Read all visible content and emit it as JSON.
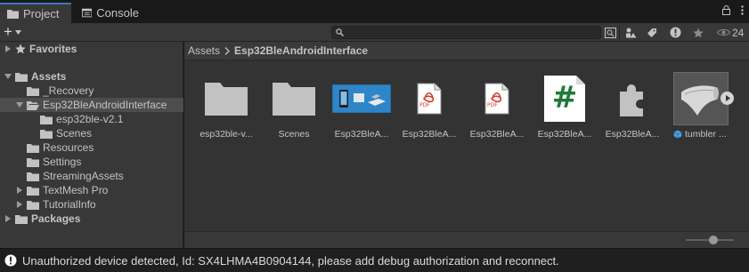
{
  "tabs": [
    {
      "label": "Project",
      "icon": "folder-icon",
      "active": true
    },
    {
      "label": "Console",
      "icon": "console-icon",
      "active": false
    }
  ],
  "toolbar": {
    "add_label": "+",
    "search_value": "",
    "hidden_count": "24"
  },
  "tree": {
    "favorites": "Favorites",
    "assets": "Assets",
    "recovery": "_Recovery",
    "esp32": "Esp32BleAndroidInterface",
    "esp32_sub": "esp32ble-v2.1",
    "scenes": "Scenes",
    "resources": "Resources",
    "settings": "Settings",
    "streaming": "StreamingAssets",
    "textmesh": "TextMesh Pro",
    "tutorial": "TutorialInfo",
    "packages": "Packages"
  },
  "breadcrumb": {
    "root": "Assets",
    "current": "Esp32BleAndroidInterface"
  },
  "grid_items": [
    {
      "label": "esp32ble-v...",
      "type": "folder"
    },
    {
      "label": "Scenes",
      "type": "folder"
    },
    {
      "label": "Esp32BleA...",
      "type": "image"
    },
    {
      "label": "Esp32BleA...",
      "type": "pdf"
    },
    {
      "label": "Esp32BleA...",
      "type": "pdf"
    },
    {
      "label": "Esp32BleA...",
      "type": "csharp"
    },
    {
      "label": "Esp32BleA...",
      "type": "plugin"
    },
    {
      "label": "tumbler ...",
      "type": "model"
    }
  ],
  "pdf_label": "PDF",
  "cs_label": "#",
  "status": {
    "message": "Unauthorized device detected, Id: SX4LHMA4B0904144, please add debug authorization and reconnect."
  },
  "colors": {
    "accent": "#3a79bb",
    "folder": "#c2c2c2",
    "pdf_red": "#d33a2c",
    "csharp_green": "#1f7a3a"
  }
}
